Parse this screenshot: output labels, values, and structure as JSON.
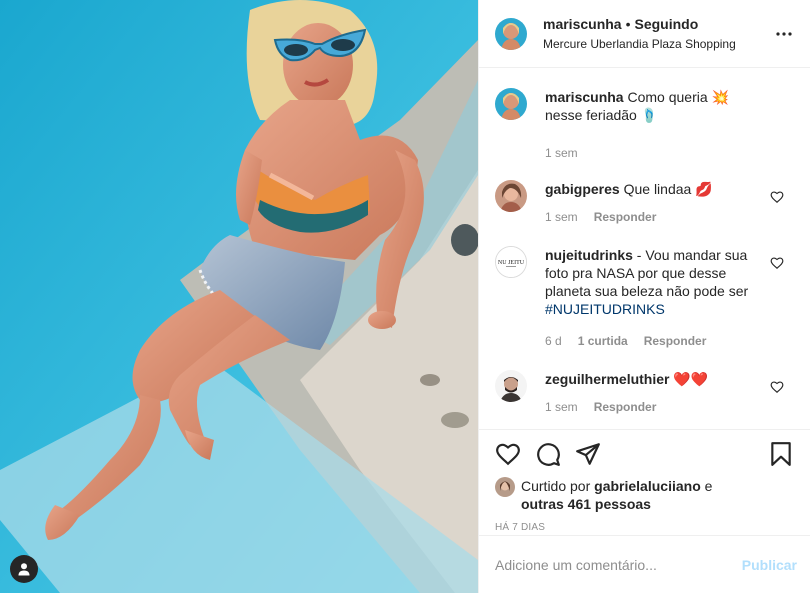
{
  "post": {
    "username": "mariscunha",
    "dot": "•",
    "following": "Seguindo",
    "location": "Mercure Uberlandia Plaza Shopping",
    "more_icon": "more-horizontal-icon",
    "tag_icon": "user-tag-icon"
  },
  "caption": {
    "username": "mariscunha",
    "text": "Como queria 💥 nesse feriadão 🩴",
    "time": "1 sem"
  },
  "comments": [
    {
      "username": "gabigperes",
      "text": "Que lindaa 💋",
      "time": "1 sem",
      "reply": "Responder",
      "likes": ""
    },
    {
      "username": "nujeitudrinks",
      "text": "- Vou mandar sua foto pra NASA por que desse planeta sua beleza não pode ser",
      "hashtag": "#NUJEITUDRINKS",
      "time": "6 d",
      "likes": "1 curtida",
      "reply": "Responder"
    },
    {
      "username": "zeguilhermeluthier",
      "text": "❤️❤️",
      "time": "1 sem",
      "reply": "Responder",
      "likes": ""
    }
  ],
  "actions": {
    "like_icon": "heart-icon",
    "comment_icon": "comment-icon",
    "share_icon": "paper-plane-icon",
    "save_icon": "bookmark-icon"
  },
  "likes": {
    "prefix": "Curtido por",
    "user": "gabrielaluciiano",
    "connector": "e",
    "others": "outras 461 pessoas"
  },
  "time_ago": "HÁ 7 DIAS",
  "add_comment": {
    "placeholder": "Adicione um comentário...",
    "publish": "Publicar"
  },
  "colors": {
    "link": "#00376b",
    "publish_disabled": "#b2dffc",
    "pool": "#35b3d6"
  }
}
